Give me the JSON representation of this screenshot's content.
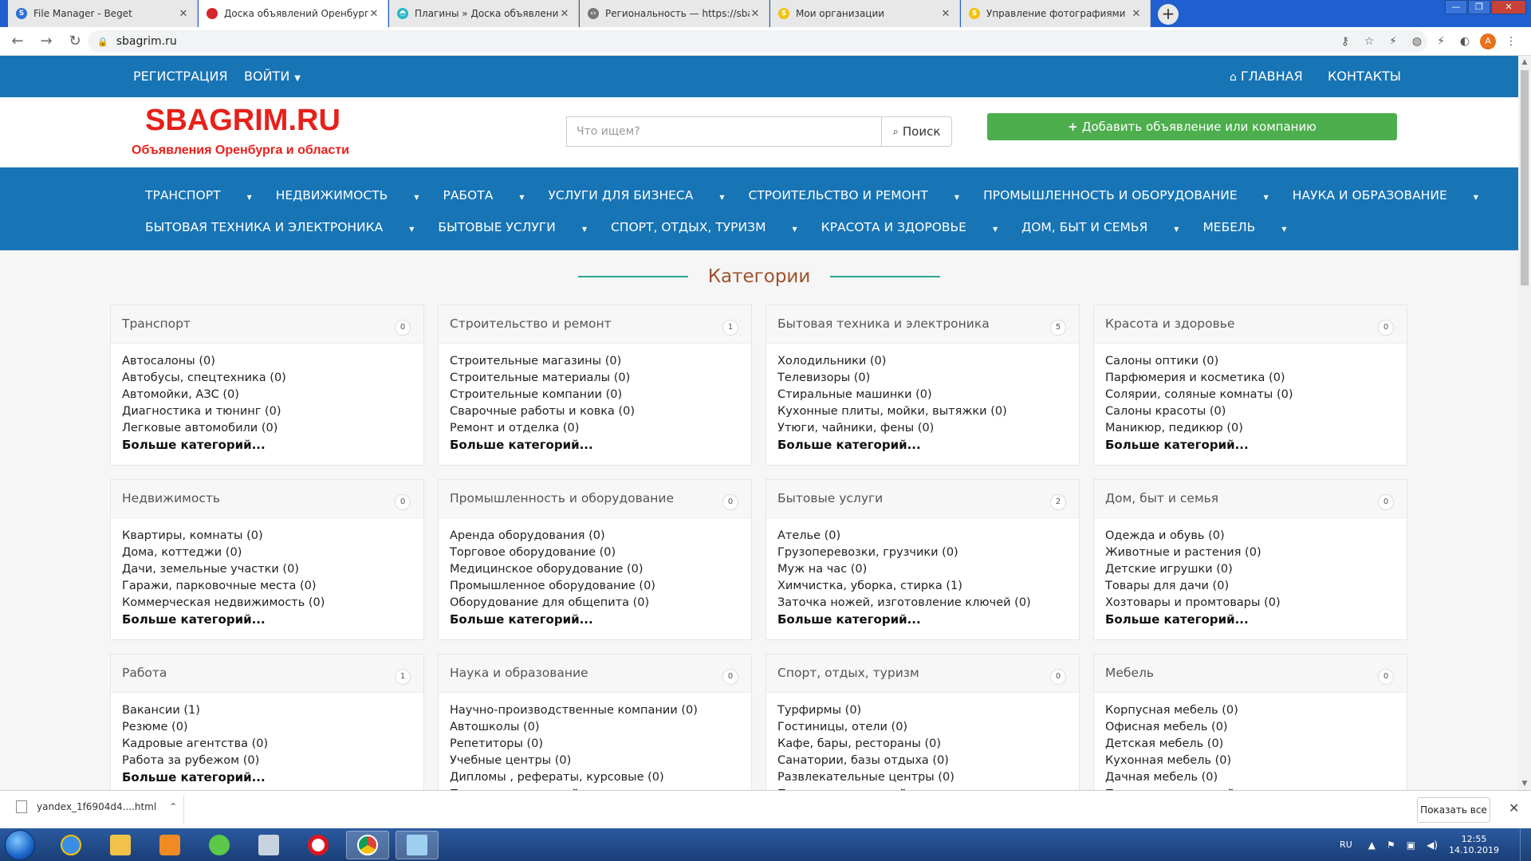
{
  "browser": {
    "tabs": [
      {
        "title": "File Manager - Beget",
        "color": "#2f6fd6",
        "glyph": "S"
      },
      {
        "title": "Доска объявлений Оренбурга и",
        "color": "#d7262b",
        "glyph": ""
      },
      {
        "title": "Плагины » Доска объявлений О",
        "color": "#2ab7c8",
        "glyph": "◓"
      },
      {
        "title": "Региональность — https://sbagr",
        "color": "#777777",
        "glyph": "‹›"
      },
      {
        "title": "Мои организации",
        "color": "#f4c20d",
        "glyph": "$"
      },
      {
        "title": "Управление фотографиями",
        "color": "#f4c20d",
        "glyph": "$"
      }
    ],
    "new_tab": "+",
    "url": "sbagrim.ru",
    "avatar_letter": "A"
  },
  "site": {
    "topnav": {
      "register": "РЕГИСТРАЦИЯ",
      "login": "ВОЙТИ",
      "home": "ГЛАВНАЯ",
      "contacts": "КОНТАКТЫ"
    },
    "logo": "SBAGRIM.RU",
    "slogan": "Объявления Оренбурга и области",
    "search": {
      "placeholder": "Что ищем?",
      "button": "Поиск"
    },
    "add_button": "Добавить объявление или компанию",
    "catnav_row1": [
      "ТРАНСПОРТ",
      "НЕДВИЖИМОСТЬ",
      "РАБОТА",
      "УСЛУГИ ДЛЯ БИЗНЕСА",
      "СТРОИТЕЛЬСТВО И РЕМОНТ",
      "ПРОМЫШЛЕННОСТЬ И ОБОРУДОВАНИЕ",
      "НАУКА И ОБРАЗОВАНИЕ"
    ],
    "catnav_row2": [
      "БЫТОВАЯ ТЕХНИКА И ЭЛЕКТРОНИКА",
      "БЫТОВЫЕ УСЛУГИ",
      "СПОРТ, ОТДЫХ, ТУРИЗМ",
      "КРАСОТА И ЗДОРОВЬЕ",
      "ДОМ, БЫТ И СЕМЬЯ",
      "МЕБЕЛЬ"
    ],
    "categories_title": "Категории",
    "more_label": "Больше категорий...",
    "cards": [
      {
        "title": "Транспорт",
        "count": "0",
        "items": [
          "Автосалоны (0)",
          "Автобусы, спецтехника (0)",
          "Автомойки, АЗС (0)",
          "Диагностика и тюнинг (0)",
          "Легковые автомобили (0)"
        ]
      },
      {
        "title": "Строительство и ремонт",
        "count": "1",
        "items": [
          "Строительные магазины (0)",
          "Строительные материалы (0)",
          "Строительные компании (0)",
          "Сварочные работы и ковка (0)",
          "Ремонт и отделка (0)"
        ]
      },
      {
        "title": "Бытовая техника и электроника",
        "count": "5",
        "items": [
          "Холодильники (0)",
          "Телевизоры (0)",
          "Стиральные машинки (0)",
          "Кухонные плиты, мойки, вытяжки (0)",
          "Утюги, чайники, фены (0)"
        ]
      },
      {
        "title": "Красота и здоровье",
        "count": "0",
        "items": [
          "Салоны оптики (0)",
          "Парфюмерия и косметика (0)",
          "Солярии, соляные комнаты (0)",
          "Салоны красоты (0)",
          "Маникюр, педикюр (0)"
        ]
      },
      {
        "title": "Недвижимость",
        "count": "0",
        "items": [
          "Квартиры, комнаты (0)",
          "Дома, коттеджи (0)",
          "Дачи, земельные участки (0)",
          "Гаражи, парковочные места (0)",
          "Коммерческая недвижимость (0)"
        ]
      },
      {
        "title": "Промышленность и оборудование",
        "count": "0",
        "items": [
          "Аренда оборудования (0)",
          "Торговое оборудование (0)",
          "Медицинское оборудование (0)",
          "Промышленное оборудование (0)",
          "Оборудование для общепита (0)"
        ]
      },
      {
        "title": "Бытовые услуги",
        "count": "2",
        "items": [
          "Ателье (0)",
          "Грузоперевозки, грузчики (0)",
          "Муж на час (0)",
          "Химчистка, уборка, стирка (1)",
          "Заточка ножей, изготовление ключей (0)"
        ]
      },
      {
        "title": "Дом, быт и семья",
        "count": "0",
        "items": [
          "Одежда и обувь (0)",
          "Животные и растения (0)",
          "Детские игрушки (0)",
          "Товары для дачи (0)",
          "Хозтовары и промтовары (0)"
        ]
      },
      {
        "title": "Работа",
        "count": "1",
        "items": [
          "Вакансии (1)",
          "Резюме (0)",
          "Кадровые агентства (0)",
          "Работа за рубежом (0)"
        ]
      },
      {
        "title": "Наука и образование",
        "count": "0",
        "items": [
          "Научно-производственные компании (0)",
          "Автошколы (0)",
          "Репетиторы (0)",
          "Учебные центры (0)",
          "Дипломы , рефераты, курсовые (0)"
        ]
      },
      {
        "title": "Спорт, отдых, туризм",
        "count": "0",
        "items": [
          "Турфирмы (0)",
          "Гостиницы, отели (0)",
          "Кафе, бары, рестораны (0)",
          "Санатории, базы отдыха (0)",
          "Развлекательные центры (0)"
        ]
      },
      {
        "title": "Мебель",
        "count": "0",
        "items": [
          "Корпусная мебель (0)",
          "Офисная мебель (0)",
          "Детская мебель (0)",
          "Кухонная мебель (0)",
          "Дачная мебель (0)"
        ]
      }
    ]
  },
  "downloads": {
    "file": "yandex_1f6904d4....html",
    "show_all": "Показать все"
  },
  "taskbar": {
    "lang": "RU",
    "time": "12:55",
    "date": "14.10.2019"
  },
  "colors": {
    "nav_blue": "#1774b5",
    "logo_red": "#e8201a",
    "add_green": "#4cae4c",
    "accent_teal": "#2aa68f",
    "title_brown": "#a0522d"
  }
}
